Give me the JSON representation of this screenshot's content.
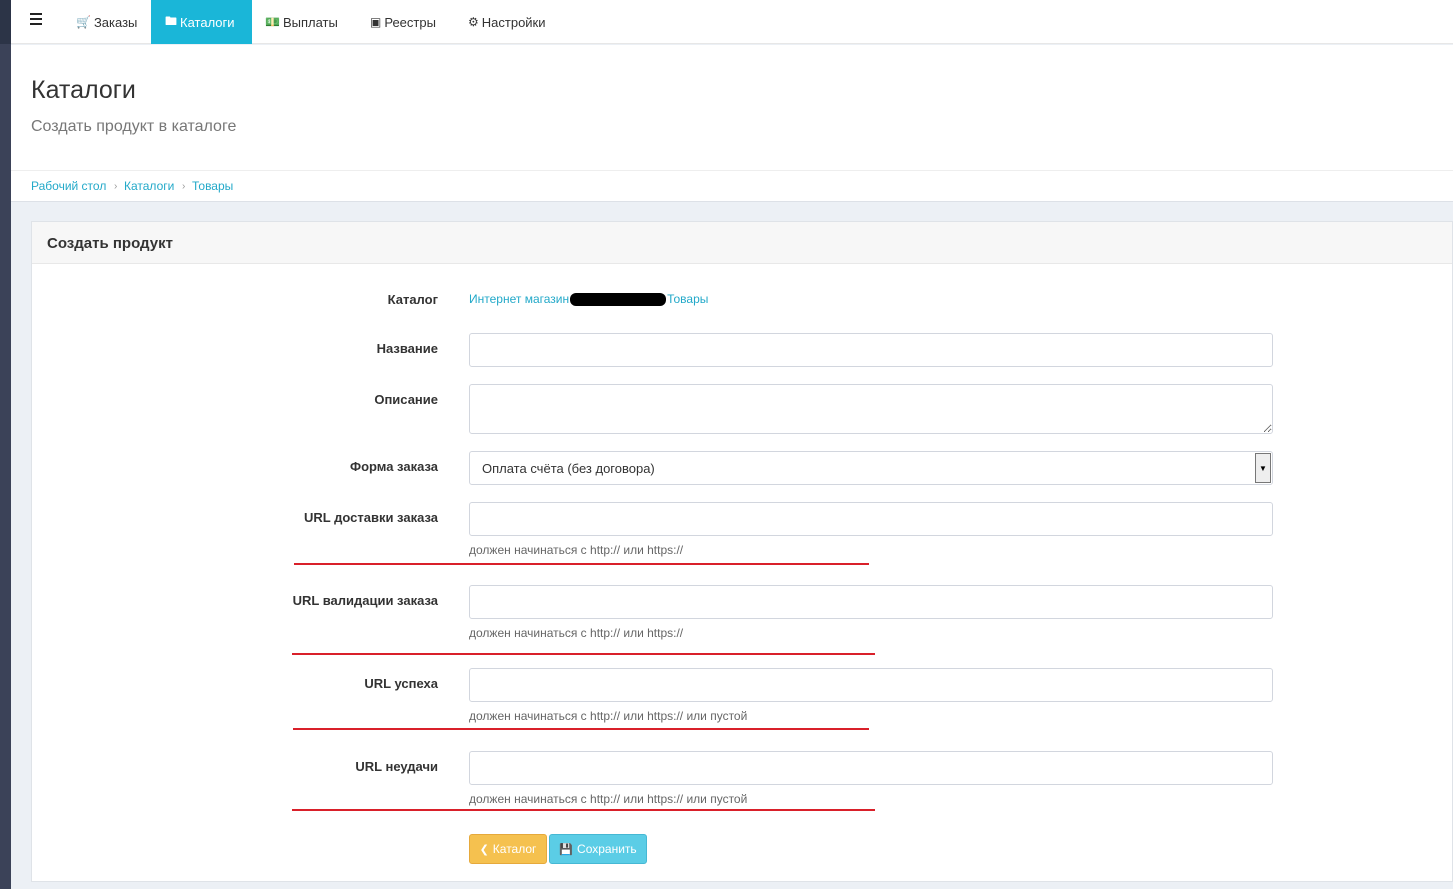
{
  "nav": {
    "items": [
      {
        "label": "Заказы",
        "icon": "cart-icon"
      },
      {
        "label": "Каталоги",
        "icon": "folder-icon"
      },
      {
        "label": "Выплаты",
        "icon": "money-icon"
      },
      {
        "label": "Реестры",
        "icon": "archive-icon"
      },
      {
        "label": "Настройки",
        "icon": "gears-icon"
      }
    ],
    "active_index": 1,
    "accent": "#1ab6d8"
  },
  "header": {
    "title": "Каталоги",
    "subtitle": "Создать продукт в каталоге"
  },
  "breadcrumb": [
    "Рабочий стол",
    "Каталоги",
    "Товары"
  ],
  "panel": {
    "title": "Создать продукт",
    "catalog": {
      "label": "Каталог",
      "value_prefix": "Интернет магазин",
      "value_suffix": "Товары"
    },
    "fields": {
      "name": {
        "label": "Название",
        "value": ""
      },
      "description": {
        "label": "Описание",
        "value": ""
      },
      "order_form": {
        "label": "Форма заказа",
        "selected": "Оплата счёта (без договора)"
      },
      "delivery_url": {
        "label": "URL доставки заказа",
        "value": "",
        "help": "должен начинаться с http:// или https://"
      },
      "validation_url": {
        "label": "URL валидации заказа",
        "value": "",
        "help": "должен начинаться с http:// или https://"
      },
      "success_url": {
        "label": "URL успеха",
        "value": "",
        "help": "должен начинаться с http:// или https:// или пустой"
      },
      "fail_url": {
        "label": "URL неудачи",
        "value": "",
        "help": "должен начинаться с http:// или https:// или пустой"
      }
    },
    "buttons": {
      "back": "Каталог",
      "save": "Сохранить"
    }
  },
  "colors": {
    "annotation_line": "#d9202a",
    "link": "#23a9c9",
    "back_button": "#f5c14f",
    "save_button": "#5bcde6"
  }
}
